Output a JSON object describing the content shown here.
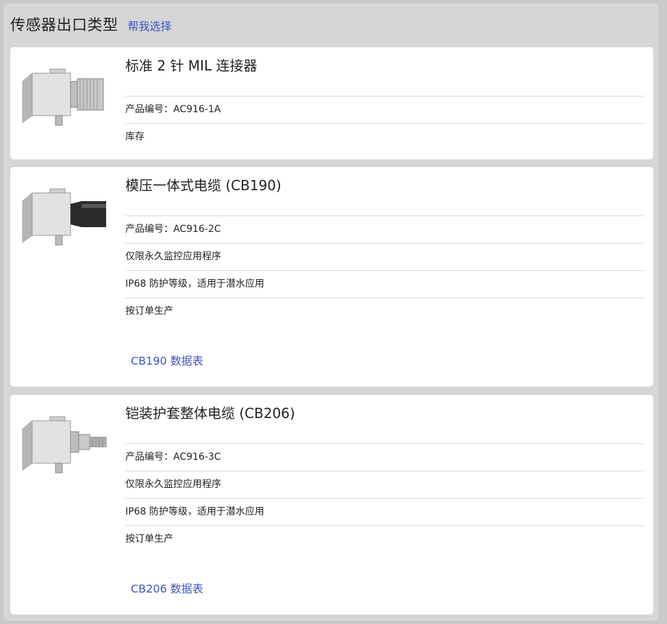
{
  "header": {
    "title": "传感器出口类型",
    "help_link": "帮我选择"
  },
  "cards": [
    {
      "title": "标准 2 针 MIL 连接器",
      "rows": [
        "产品编号：AC916-1A",
        "库存"
      ],
      "connector": "mil-connector-icon"
    },
    {
      "title": "模压一体式电缆 (CB190)",
      "rows": [
        "产品编号：AC916-2C",
        "仅限永久监控应用程序",
        "IP68 防护等级，适用于潜水应用",
        "按订单生产"
      ],
      "datasheet": "CB190 数据表",
      "connector": "molded-cable-icon"
    },
    {
      "title": "铠装护套整体电缆 (CB206)",
      "rows": [
        "产品编号：AC916-3C",
        "仅限永久监控应用程序",
        "IP68 防护等级，适用于潜水应用",
        "按订单生产"
      ],
      "datasheet": "CB206 数据表",
      "connector": "armored-cable-icon"
    }
  ]
}
